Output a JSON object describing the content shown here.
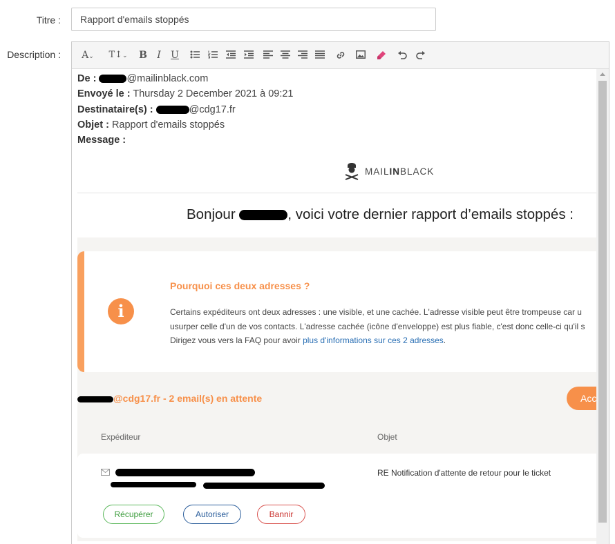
{
  "form": {
    "title_label": "Titre :",
    "title_value": "Rapport d'emails stoppés",
    "description_label": "Description :"
  },
  "toolbar": {
    "icons": [
      "font-color-icon",
      "font-size-icon",
      "bold-icon",
      "italic-icon",
      "underline-icon",
      "bullet-list-icon",
      "numbered-list-icon",
      "outdent-icon",
      "indent-icon",
      "align-left-icon",
      "align-center-icon",
      "align-right-icon",
      "justify-icon",
      "link-icon",
      "image-icon",
      "highlighter-icon",
      "undo-icon",
      "redo-icon"
    ],
    "font_color_glyph": "A",
    "font_size_glyph": "T↕",
    "bold_glyph": "B",
    "italic_glyph": "I",
    "underline_glyph": "U",
    "highlight_color": "#e0457b"
  },
  "email": {
    "from_label": "De :",
    "from_value": "@mailinblack.com",
    "sent_label": "Envoyé le :",
    "sent_value": "Thursday 2 December 2021 à 09:21",
    "to_label": "Destinataire(s) :",
    "to_value": "@cdg17.fr",
    "subject_label": "Objet :",
    "subject_value": "Rapport d'emails stoppés",
    "message_label": "Message :"
  },
  "logo": {
    "text_light": "MAIL",
    "text_bold": "IN",
    "text_light2": "BLACK"
  },
  "greeting": {
    "before": "Bonjour ",
    "after": ", voici votre dernier rapport d’emails stoppés :"
  },
  "info": {
    "icon_glyph": "i",
    "title": "Pourquoi ces deux adresses ?",
    "line1": "Certains expéditeurs ont deux adresses : une visible, et une cachée. L'adresse visible peut être trompeuse car u",
    "line2": "usurper celle d'un de vos contacts. L'adresse cachée (icône d'enveloppe) est plus fiable, c'est donc celle-ci qu'il s",
    "line3_before": "Dirigez vous vers la FAQ pour avoir ",
    "line3_link": "plus d'informations sur ces 2 adresses",
    "line3_after": ".",
    "accent_color": "#f7904a"
  },
  "pending": {
    "text": "@cdg17.fr - 2 email(s) en attente",
    "accept_label": "Acc"
  },
  "table": {
    "col_sender": "Expéditeur",
    "col_subject": "Objet"
  },
  "mail_item": {
    "subject": "RE Notification d'attente de retour pour le ticket",
    "recover_label": "Récupérer",
    "allow_label": "Autoriser",
    "ban_label": "Bannir"
  }
}
